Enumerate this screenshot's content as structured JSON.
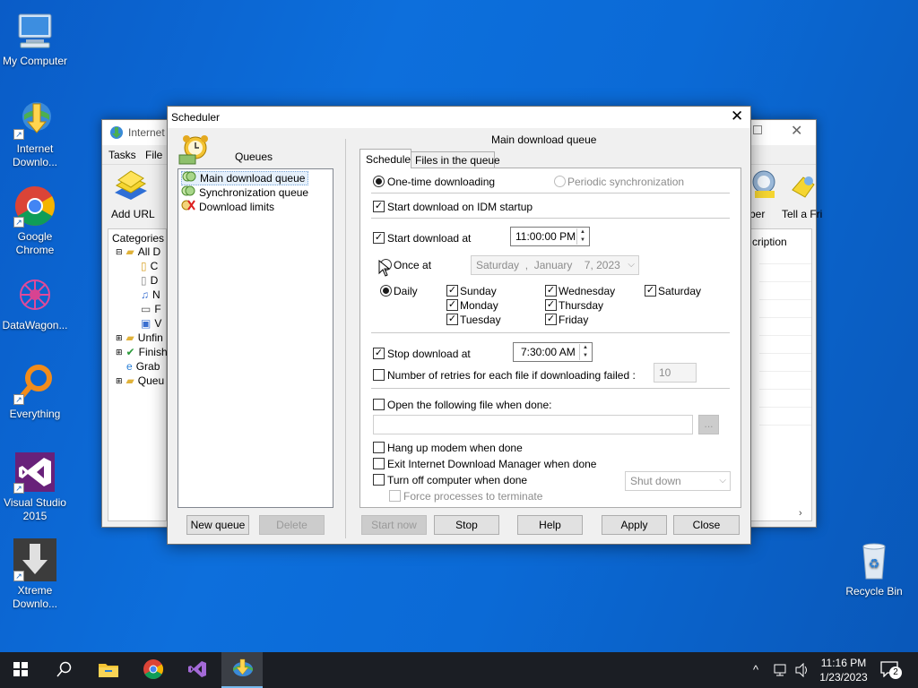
{
  "desktop": {
    "icons": [
      {
        "label": "My Computer"
      },
      {
        "label": "Internet Downlo..."
      },
      {
        "label": "Google Chrome"
      },
      {
        "label": "DataWagon..."
      },
      {
        "label": "Everything"
      },
      {
        "label": "Visual Studio 2015"
      },
      {
        "label": "Xtreme Downlo..."
      }
    ],
    "recycle_bin": "Recycle Bin"
  },
  "idm_window": {
    "title": "Internet",
    "menu": [
      "Tasks",
      "File"
    ],
    "add_url": "Add URL",
    "categories_header": "Categories",
    "tree": [
      "All D",
      "C",
      "D",
      "N",
      "F",
      "V",
      "Unfin",
      "Finish",
      "Grab",
      "Queu"
    ],
    "right_toolbar": [
      "ber",
      "Tell a Fri"
    ],
    "column_header": "cription"
  },
  "dialog": {
    "title": "Scheduler",
    "queues_label": "Queues",
    "queue_items": [
      "Main download queue",
      "Synchronization queue",
      "Download limits"
    ],
    "new_queue": "New queue",
    "delete": "Delete",
    "queue_name_header": "Main download queue",
    "tabs": [
      "Schedule",
      "Files in the queue"
    ],
    "one_time": "One-time downloading",
    "periodic": "Periodic synchronization",
    "start_on_startup": "Start download on IDM startup",
    "start_at_label": "Start download at",
    "start_time": "11:00:00 PM",
    "once_at": "Once at",
    "once_date": {
      "day": "Saturday",
      "sep": ",",
      "month": "January",
      "date": "7, 2023"
    },
    "daily": "Daily",
    "days": [
      "Sunday",
      "Monday",
      "Tuesday",
      "Wednesday",
      "Thursday",
      "Friday",
      "Saturday"
    ],
    "stop_at_label": "Stop download at",
    "stop_time": "7:30:00 AM",
    "retries_label": "Number of retries for each file if downloading failed :",
    "retries_value": "10",
    "open_file_label": "Open the following file when done:",
    "browse": "...",
    "hang_up": "Hang up modem when done",
    "exit_idm": "Exit Internet Download Manager when done",
    "turn_off": "Turn off computer when done",
    "shutdown_option": "Shut down",
    "force": "Force processes to terminate",
    "buttons": {
      "start_now": "Start now",
      "stop": "Stop",
      "help": "Help",
      "apply": "Apply",
      "close": "Close"
    }
  },
  "taskbar": {
    "time": "11:16 PM",
    "date": "1/23/2023",
    "notification_count": "2"
  }
}
